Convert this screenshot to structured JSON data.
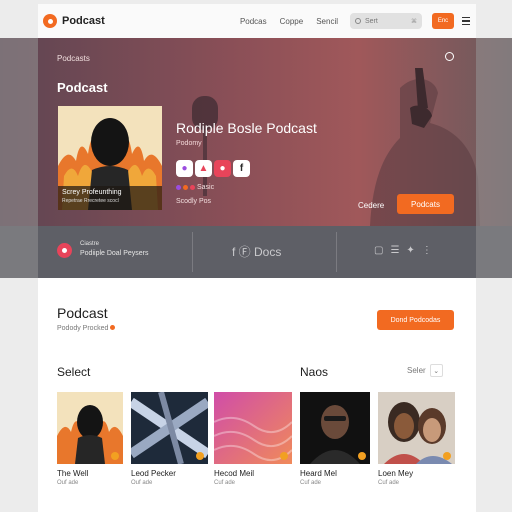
{
  "app": {
    "logo_text": "Podcast",
    "nav": [
      "Podcas",
      "Coppe",
      "Sencil"
    ],
    "search_placeholder": "Sert",
    "search_shortcut": "⌘",
    "cta_label": "Enc"
  },
  "hero": {
    "breadcrumb": "Podcasts",
    "title": "Podcast",
    "show_title": "Rodiple Bosle Podcast",
    "show_subtitle": "Podomy",
    "cover_caption_title": "Screy Profeunthing",
    "cover_caption_sub": "Repetrae Rrecretee scocl",
    "meta_line1": "Sasic",
    "meta_line2": "Scodly Pos",
    "secondary_label": "Cedere",
    "cta_label": "Podcats"
  },
  "strip": {
    "line1": "Ciastre",
    "line2": "Podiiple Doal Peysers",
    "mid_text": "f  Ⓕ Docs"
  },
  "section": {
    "title": "Podcast",
    "subtitle": "Podody Procked",
    "cta_label": "Dond Podcodas",
    "left_heading": "Select",
    "right_heading": "Naos",
    "sort_label": "Seler",
    "sort_icon": "⌄"
  },
  "cards": [
    {
      "title": "The Well",
      "sub": "Ouf ade"
    },
    {
      "title": "Leod Pecker",
      "sub": "Ouf ade"
    },
    {
      "title": "Hecod Meil",
      "sub": "Cuf ade"
    },
    {
      "title": "Heard Mel",
      "sub": "Cuf ade"
    },
    {
      "title": "Loen Mey",
      "sub": "Cuf ade"
    }
  ],
  "colors": {
    "accent": "#f26a21",
    "hero_gradient_start": "#5e4552",
    "hero_gradient_end": "#a0585a",
    "strip": "#5e5f66"
  }
}
